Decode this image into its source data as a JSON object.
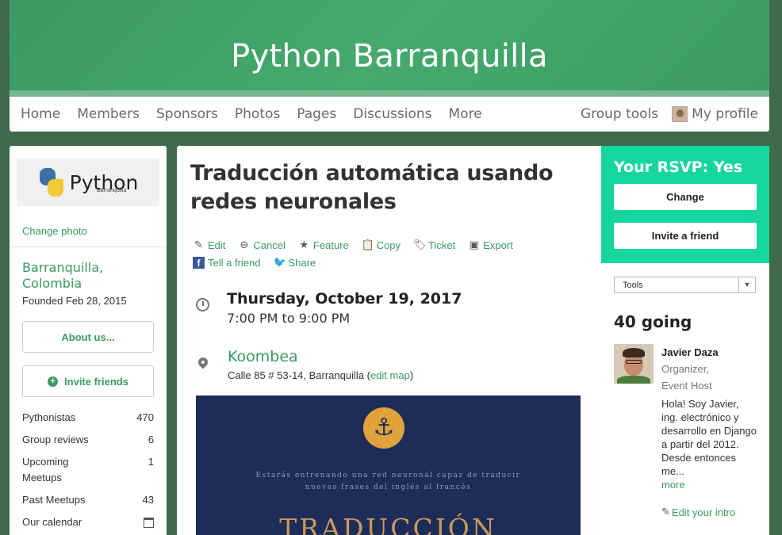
{
  "group": {
    "name": "Python Barranquilla"
  },
  "nav": {
    "items": [
      "Home",
      "Members",
      "Sponsors",
      "Photos",
      "Pages",
      "Discussions",
      "More"
    ],
    "group_tools": "Group tools",
    "my_profile": "My profile"
  },
  "sidebar": {
    "logo_text": "Python",
    "logo_sub": "Barranquilla",
    "change_photo": "Change photo",
    "location": "Barranquilla, Colombia",
    "founded": "Founded Feb 28, 2015",
    "about_button": "About us...",
    "invite_button": "Invite friends",
    "stats": [
      {
        "label": "Pythonistas",
        "value": "470"
      },
      {
        "label": "Group reviews",
        "value": "6"
      },
      {
        "label": "Upcoming Meetups",
        "value": "1"
      },
      {
        "label": "Past Meetups",
        "value": "43"
      },
      {
        "label": "Our calendar",
        "value": ""
      }
    ]
  },
  "event": {
    "title": "Traducción automática usando redes neuronales",
    "actions": {
      "edit": "Edit",
      "cancel": "Cancel",
      "feature": "Feature",
      "copy": "Copy",
      "ticket": "Ticket",
      "export": "Export",
      "tell_friend": "Tell a friend",
      "share": "Share"
    },
    "date": "Thursday, October 19, 2017",
    "time": "7:00 PM to 9:00 PM",
    "venue": "Koombea",
    "address": "Calle 85 # 53-14, Barranquilla",
    "edit_map": "edit map",
    "poster": {
      "tagline_1": "Estarás entrenando una red neuronal capaz de traducir",
      "tagline_2": "nuevas frases del inglés al francés",
      "big_text": "TRADUCCIÓN"
    }
  },
  "rsvp": {
    "title": "Your RSVP: Yes",
    "change_button": "Change",
    "invite_button": "Invite a friend",
    "tools_select": "Tools"
  },
  "attendees": {
    "count_label": "40 going",
    "host": {
      "name": "Javier Daza",
      "role_1": "Organizer,",
      "role_2": "Event Host",
      "bio": "Hola! Soy Javier, ing. electrónico y desarrollo en Django a partir del 2012. Desde entonces me...",
      "more": "more"
    },
    "edit_intro": "Edit your intro"
  },
  "colors": {
    "brand_green": "#3b9a64",
    "rsvp_teal": "#16d6a0",
    "background": "#3f6b4a",
    "poster_navy": "#1e2c58",
    "poster_gold": "#e0a23b"
  }
}
